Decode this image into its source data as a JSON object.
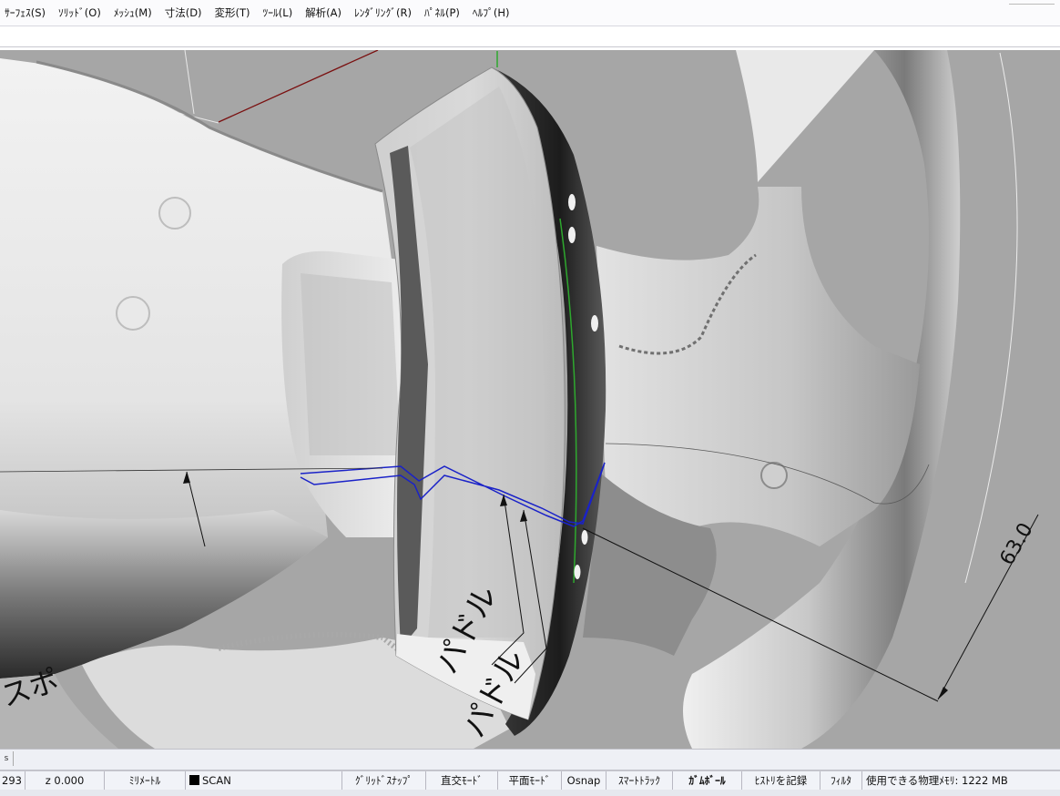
{
  "menu": {
    "items": [
      "ｻｰﾌｪｽ(S)",
      "ｿﾘｯﾄﾞ(O)",
      "ﾒｯｼｭ(M)",
      "寸法(D)",
      "変形(T)",
      "ﾂｰﾙ(L)",
      "解析(A)",
      "ﾚﾝﾀﾞﾘﾝｸﾞ(R)",
      "ﾊﾟﾈﾙ(P)",
      "ﾍﾙﾌﾟ(H)"
    ]
  },
  "command": {
    "value": ""
  },
  "viewport": {
    "annotations": {
      "dimension": "63.0",
      "label_paddle": "パドル",
      "label_paddle_lower": "パドル",
      "label_spoke_partial": "スポ"
    },
    "colors": {
      "background": "#a6a6a6",
      "section_curve": "#1a22c8",
      "axis_x": "#7a1010",
      "axis_y": "#2ea82e",
      "leader": "#111111"
    }
  },
  "scroll_strip": {
    "cell": "s"
  },
  "status": {
    "coord_x": "293",
    "coord_z": "z 0.000",
    "units": "ﾐﾘﾒｰﾄﾙ",
    "layer": "SCAN",
    "layer_color": "#000000",
    "grid_snap": "ｸﾞﾘｯﾄﾞｽﾅｯﾌﾟ",
    "ortho": "直交ﾓｰﾄﾞ",
    "planar": "平面ﾓｰﾄﾞ",
    "osnap": "Osnap",
    "smart_track": "ｽﾏｰﾄﾄﾗｯｸ",
    "gumball": "ｶﾞﾑﾎﾞｰﾙ",
    "record_history": "ﾋｽﾄﾘを記録",
    "filter": "ﾌｨﾙﾀ",
    "memory": "使用できる物理ﾒﾓﾘ: 1222 MB"
  }
}
